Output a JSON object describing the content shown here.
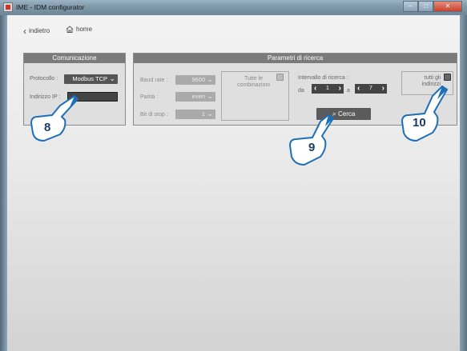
{
  "window": {
    "title": "IME - IDM configurator"
  },
  "nav": {
    "back_label": "indietro",
    "home_label": "home"
  },
  "comunicazione": {
    "title": "Comunicazione",
    "protocol_label": "Protocollo :",
    "protocol_value": "Modbus TCP",
    "ip_label": "Indirizzo IP :",
    "ip_value": ""
  },
  "ricerca": {
    "title": "Parametri di ricerca",
    "baud_label": "Baud rate :",
    "baud_value": "9600",
    "parity_label": "Parità :",
    "parity_value": "even",
    "stopbit_label": "Bit di stop :",
    "stopbit_value": "1",
    "all_combinations_label": "Tutte le combinazioni",
    "range_label": "Intervallo di ricerca :",
    "from_label": "da",
    "from_value": "1",
    "to_label": "a",
    "to_value": "7",
    "all_addresses_label": "tutti gli indirizzi",
    "search_button": "Cerca"
  },
  "callouts": {
    "c8": "8",
    "c9": "9",
    "c10": "10"
  },
  "colors": {
    "panel_header": "#7b7b7b",
    "field_bg": "#555555",
    "callout_border": "#2a7fc9"
  }
}
